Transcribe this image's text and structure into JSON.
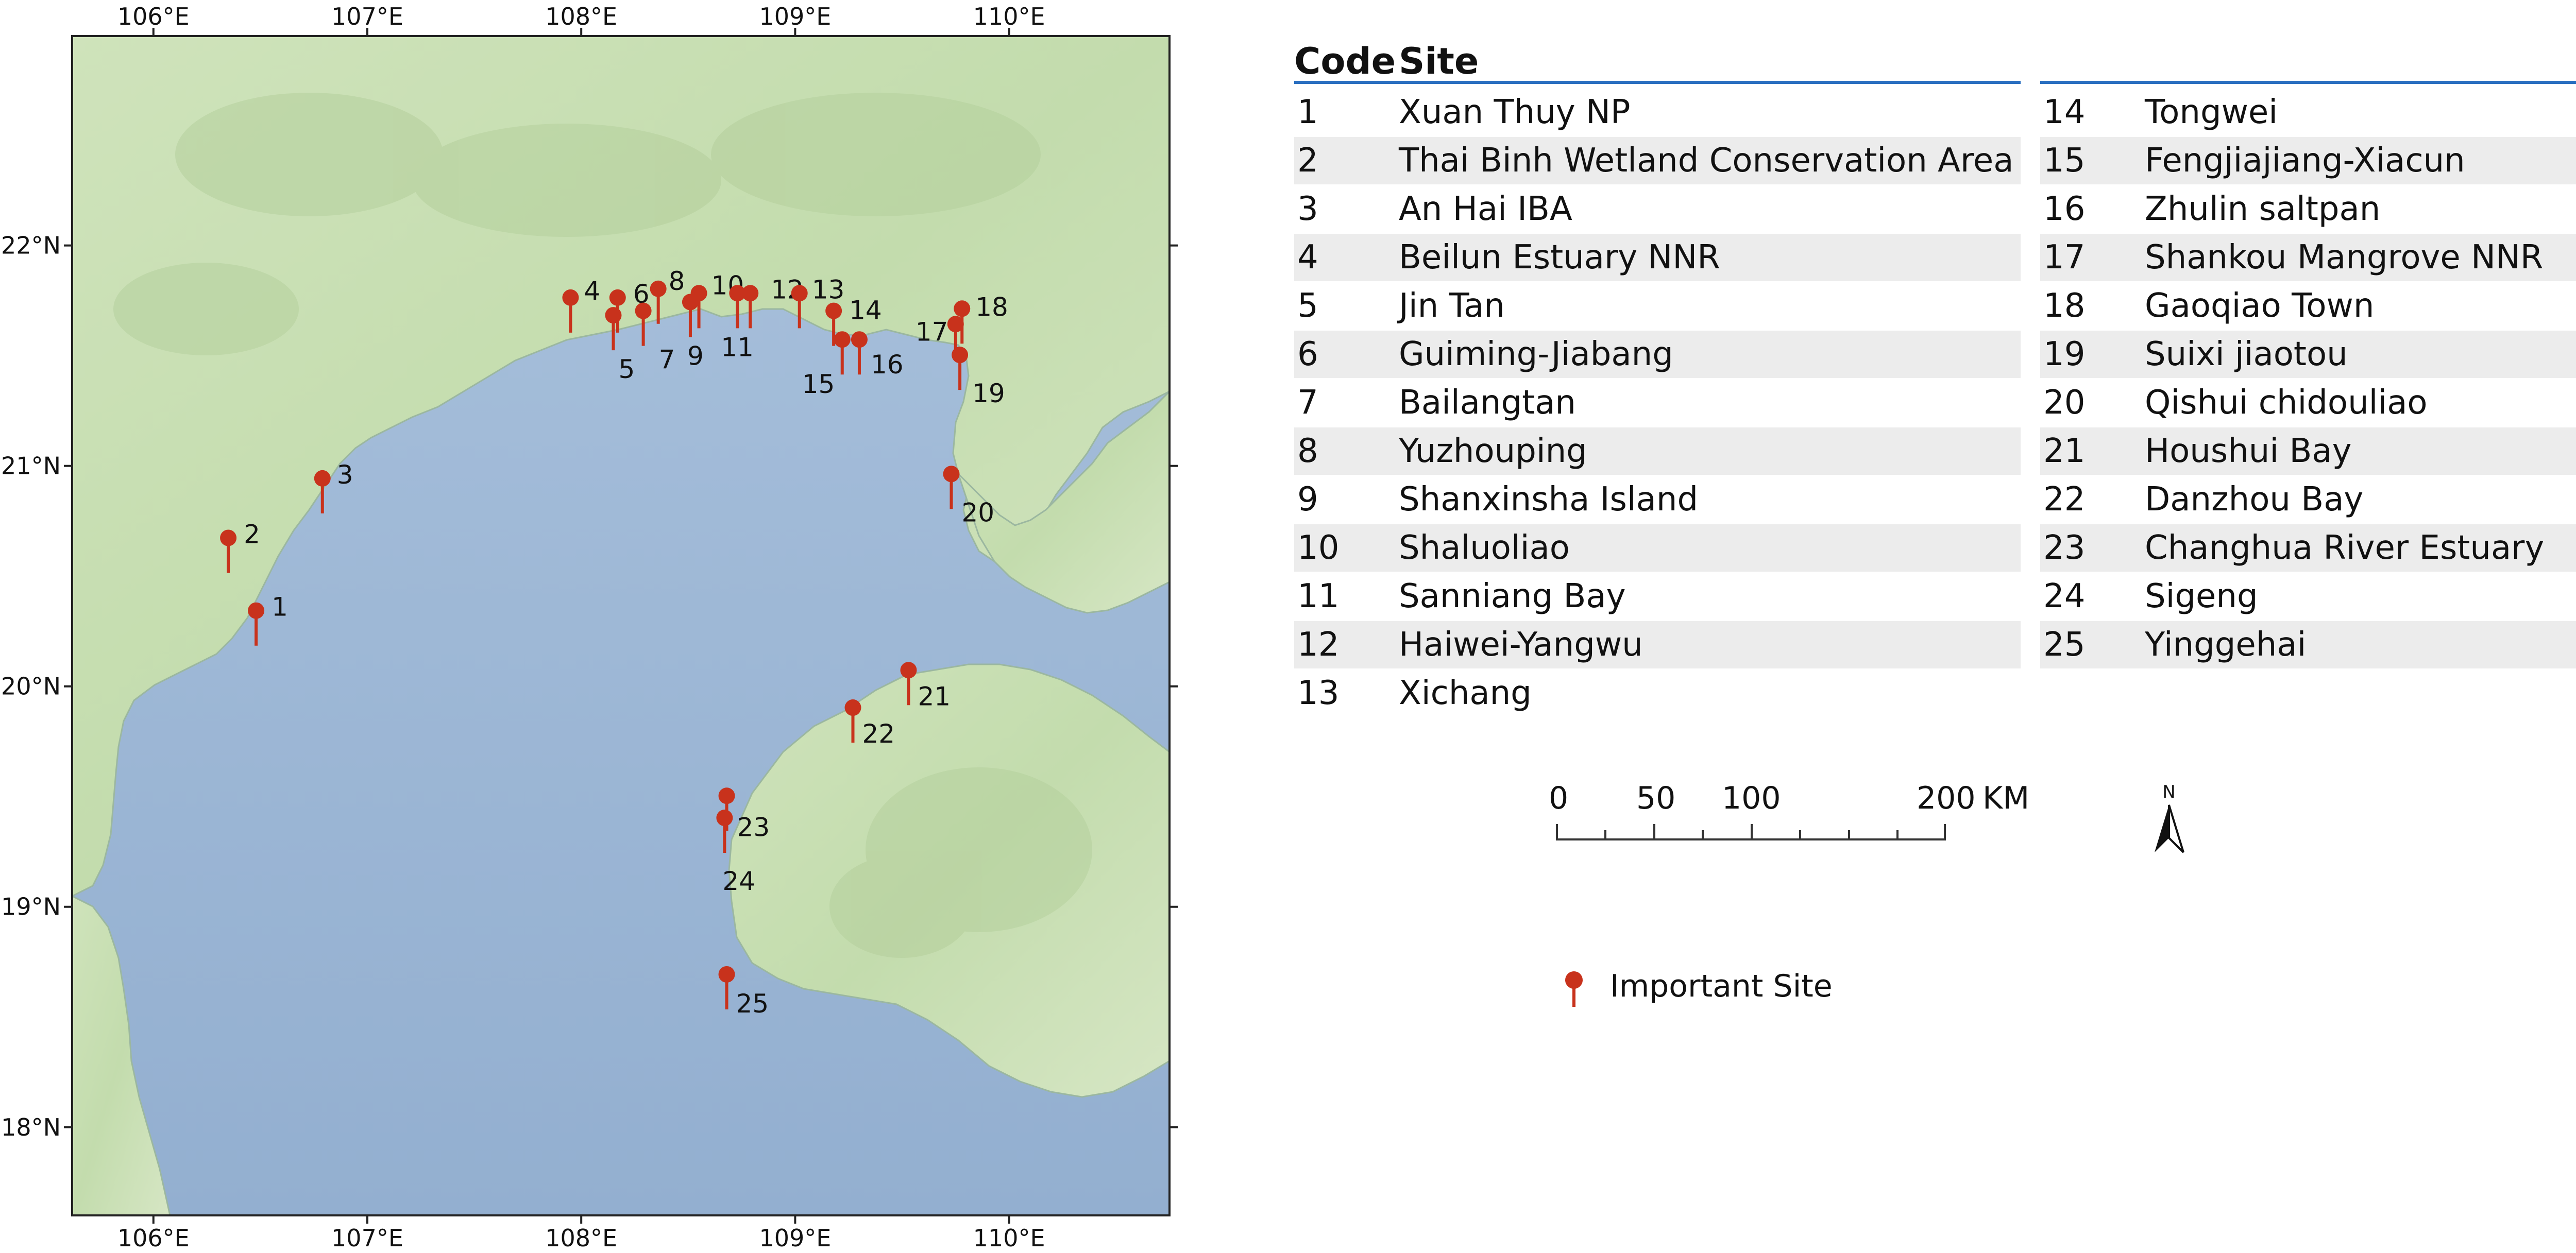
{
  "map": {
    "longitude_labels": [
      "106°E",
      "107°E",
      "108°E",
      "109°E",
      "110°E"
    ],
    "latitude_labels": [
      "22°N",
      "21°N",
      "20°N",
      "19°N",
      "18°N"
    ],
    "markers": [
      {
        "code": "1",
        "lon": 106.48,
        "lat": 20.25
      },
      {
        "code": "2",
        "lon": 106.35,
        "lon_lbl": 0,
        "lat": 20.58
      },
      {
        "code": "3",
        "lon": 106.79,
        "lat": 20.85
      },
      {
        "code": "4",
        "lon": 107.95,
        "lat": 21.67
      },
      {
        "code": "5",
        "lon": 108.15,
        "lat": 21.59
      },
      {
        "code": "6",
        "lon": 108.17,
        "lat": 21.67
      },
      {
        "code": "7",
        "lon": 108.29,
        "lat": 21.61
      },
      {
        "code": "8",
        "lon": 108.36,
        "lat": 21.71
      },
      {
        "code": "9",
        "lon": 108.51,
        "lat": 21.65
      },
      {
        "code": "10",
        "lon": 108.55,
        "lat": 21.69
      },
      {
        "code": "11",
        "lon": 108.73,
        "lat": 21.69
      },
      {
        "code": "12",
        "lon": 108.79,
        "lat": 21.69
      },
      {
        "code": "13",
        "lon": 109.02,
        "lat": 21.69
      },
      {
        "code": "14",
        "lon": 109.18,
        "lat": 21.61
      },
      {
        "code": "15",
        "lon": 109.22,
        "lat": 21.48
      },
      {
        "code": "16",
        "lon": 109.3,
        "lat": 21.48
      },
      {
        "code": "17",
        "lon": 109.75,
        "lat": 21.55
      },
      {
        "code": "18",
        "lon": 109.78,
        "lat": 21.62
      },
      {
        "code": "19",
        "lon": 109.77,
        "lat": 21.41
      },
      {
        "code": "20",
        "lon": 109.73,
        "lat": 20.87
      },
      {
        "code": "21",
        "lon": 109.53,
        "lat": 19.98
      },
      {
        "code": "22",
        "lon": 109.27,
        "lat": 19.81
      },
      {
        "code": "23",
        "lon": 108.68,
        "lat": 19.41
      },
      {
        "code": "24",
        "lon": 108.67,
        "lat": 19.31
      },
      {
        "code": "25",
        "lon": 108.68,
        "lat": 18.6
      }
    ]
  },
  "table": {
    "header_code": "Code",
    "header_site": "Site",
    "rows": [
      {
        "code": "1",
        "site": "Xuan Thuy NP"
      },
      {
        "code": "2",
        "site": "Thai Binh Wetland Conservation Area"
      },
      {
        "code": "3",
        "site": "An Hai IBA"
      },
      {
        "code": "4",
        "site": "Beilun Estuary NNR"
      },
      {
        "code": "5",
        "site": "Jin Tan"
      },
      {
        "code": "6",
        "site": "Guiming-Jiabang"
      },
      {
        "code": "7",
        "site": "Bailangtan"
      },
      {
        "code": "8",
        "site": "Yuzhouping"
      },
      {
        "code": "9",
        "site": "Shanxinsha Island"
      },
      {
        "code": "10",
        "site": "Shaluoliao"
      },
      {
        "code": "11",
        "site": "Sanniang Bay"
      },
      {
        "code": "12",
        "site": "Haiwei-Yangwu"
      },
      {
        "code": "13",
        "site": "Xichang"
      },
      {
        "code": "14",
        "site": "Tongwei"
      },
      {
        "code": "15",
        "site": "Fengjiajiang-Xiacun"
      },
      {
        "code": "16",
        "site": "Zhulin saltpan"
      },
      {
        "code": "17",
        "site": "Shankou Mangrove NNR"
      },
      {
        "code": "18",
        "site": "Gaoqiao Town"
      },
      {
        "code": "19",
        "site": "Suixi jiaotou"
      },
      {
        "code": "20",
        "site": "Qishui chidouliao"
      },
      {
        "code": "21",
        "site": "Houshui Bay"
      },
      {
        "code": "22",
        "site": "Danzhou Bay"
      },
      {
        "code": "23",
        "site": "Changhua River Estuary"
      },
      {
        "code": "24",
        "site": "Sigeng"
      },
      {
        "code": "25",
        "site": "Yinggehai"
      }
    ]
  },
  "scalebar": {
    "labels": [
      "0",
      "50",
      "100",
      "200"
    ],
    "unit": "KM"
  },
  "north_arrow": {
    "label": "N"
  },
  "legend": {
    "label": "Important Site"
  },
  "colors": {
    "sea": "#9fb8d6",
    "land": "#c6dfb0",
    "marker": "#c8321c",
    "rule": "#2a6fc0"
  }
}
